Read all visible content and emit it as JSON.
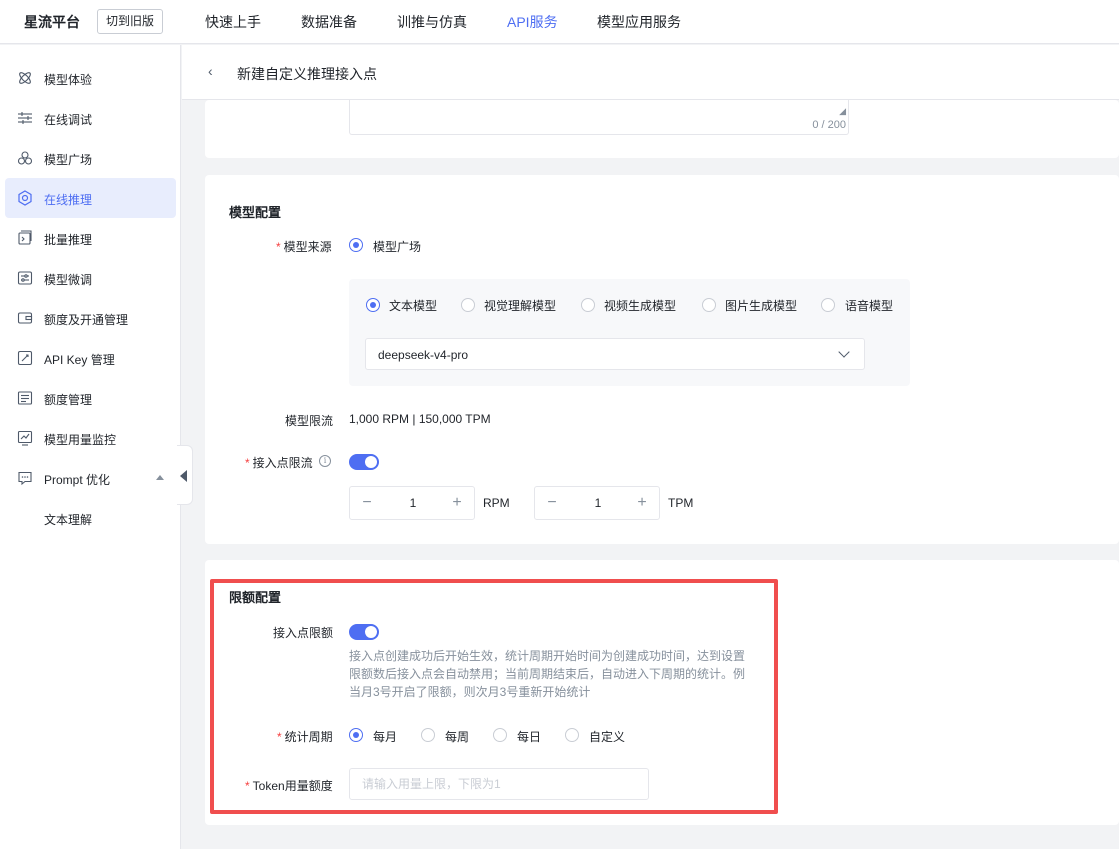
{
  "header": {
    "brand": "星流平台",
    "switch_label": "切到旧版",
    "nav": [
      "快速上手",
      "数据准备",
      "训推与仿真",
      "API服务",
      "模型应用服务"
    ],
    "active_color": "#4e6ef2"
  },
  "sidebar": {
    "items": [
      {
        "label": "模型体验",
        "icon": "atom-icon"
      },
      {
        "label": "在线调试",
        "icon": "sliders-icon"
      },
      {
        "label": "模型广场",
        "icon": "cluster-icon"
      },
      {
        "label": "在线推理",
        "icon": "gear-hex-icon"
      },
      {
        "label": "批量推理",
        "icon": "batch-icon"
      },
      {
        "label": "模型微调",
        "icon": "tune-icon"
      },
      {
        "label": "额度及开通管理",
        "icon": "wallet-icon"
      },
      {
        "label": "API Key 管理",
        "icon": "key-icon"
      },
      {
        "label": "额度管理",
        "icon": "list-icon"
      },
      {
        "label": "模型用量监控",
        "icon": "chart-icon"
      },
      {
        "label": "Prompt 优化",
        "icon": "chat-icon"
      }
    ],
    "sub_item": "文本理解"
  },
  "page": {
    "back": "‹",
    "title": "新建自定义推理接入点"
  },
  "description": {
    "counter": "0 / 200"
  },
  "model_config": {
    "title": "模型配置",
    "source_label": "模型来源",
    "source_option": "模型广场",
    "model_types": [
      "文本模型",
      "视觉理解模型",
      "视频生成模型",
      "图片生成模型",
      "语音模型"
    ],
    "selected_model": "deepseek-v4-pro",
    "limit_label": "模型限流",
    "limit_value": "1,000 RPM | 150,000 TPM",
    "endpoint_limit_label": "接入点限流",
    "rpm_value": "1",
    "rpm_unit": "RPM",
    "tpm_value": "1",
    "tpm_unit": "TPM",
    "minus": "−",
    "plus": "+"
  },
  "quota_config": {
    "title": "限额配置",
    "endpoint_quota_label": "接入点限额",
    "help_text": "接入点创建成功后开始生效，统计周期开始时间为创建成功时间，达到设置限额数后接入点会自动禁用；当前周期结束后，自动进入下周期的统计。例当月3号开启了限额，则次月3号重新开始统计",
    "period_label": "统计周期",
    "periods": [
      "每月",
      "每周",
      "每日",
      "自定义"
    ],
    "token_label": "Token用量额度",
    "token_placeholder": "请输入用量上限，下限为1"
  }
}
